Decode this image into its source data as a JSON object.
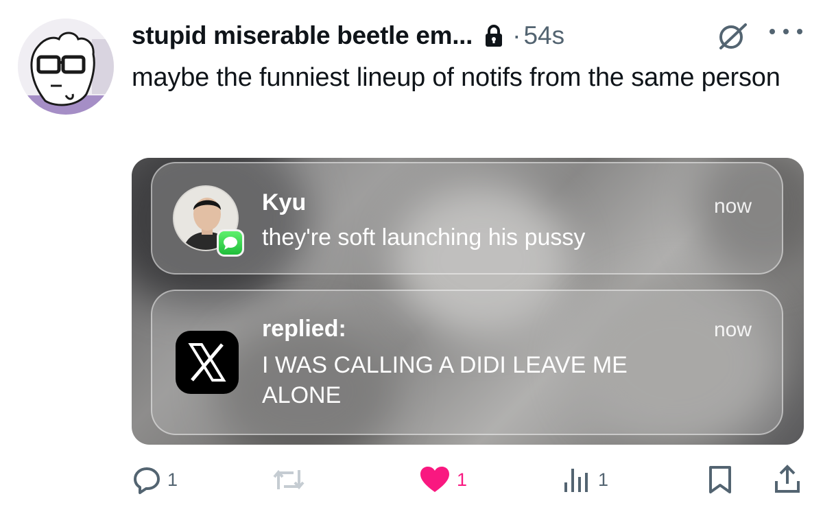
{
  "author": {
    "display_name": "stupid miserable beetle em...",
    "time_ago": "54s",
    "separator": "·"
  },
  "tweet": {
    "text": "maybe the funniest lineup of notifs from the same person"
  },
  "notifications": [
    {
      "app": "Messages",
      "sender": "Kyu",
      "body": "they're soft launching his pussy",
      "time": "now"
    },
    {
      "app": "X",
      "title": "replied:",
      "body": "I WAS CALLING A DIDI LEAVE ME ALONE",
      "time": "now"
    }
  ],
  "actions": {
    "reply_count": "1",
    "retweet_count": "",
    "like_count": "1",
    "views_count": "1"
  },
  "colors": {
    "text_primary": "#0f1419",
    "text_secondary": "#536471",
    "like_pink": "#f91880",
    "messages_green": "#34c759"
  },
  "icons": [
    "lock-icon",
    "grok-icon",
    "more-icon",
    "reply-icon",
    "retweet-icon",
    "heart-icon",
    "views-icon",
    "bookmark-icon",
    "share-icon",
    "x-logo-icon"
  ]
}
